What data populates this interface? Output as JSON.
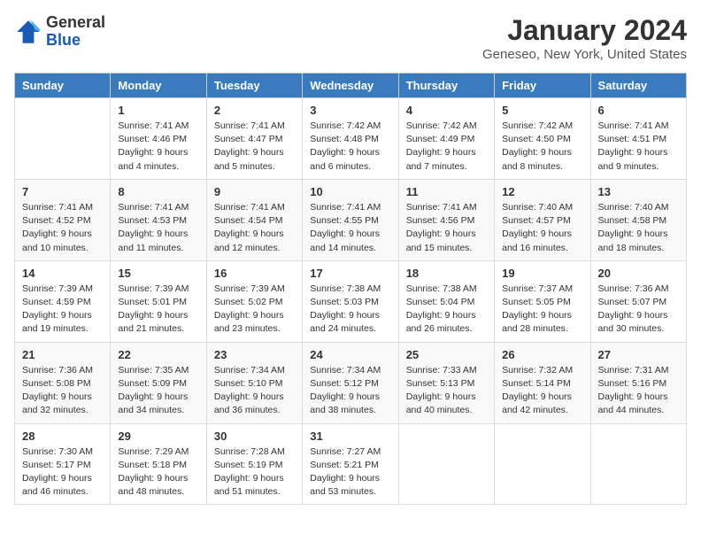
{
  "logo": {
    "line1": "General",
    "line2": "Blue"
  },
  "title": "January 2024",
  "subtitle": "Geneseo, New York, United States",
  "headers": [
    "Sunday",
    "Monday",
    "Tuesday",
    "Wednesday",
    "Thursday",
    "Friday",
    "Saturday"
  ],
  "weeks": [
    [
      {
        "date": "",
        "info": ""
      },
      {
        "date": "1",
        "info": "Sunrise: 7:41 AM\nSunset: 4:46 PM\nDaylight: 9 hours\nand 4 minutes."
      },
      {
        "date": "2",
        "info": "Sunrise: 7:41 AM\nSunset: 4:47 PM\nDaylight: 9 hours\nand 5 minutes."
      },
      {
        "date": "3",
        "info": "Sunrise: 7:42 AM\nSunset: 4:48 PM\nDaylight: 9 hours\nand 6 minutes."
      },
      {
        "date": "4",
        "info": "Sunrise: 7:42 AM\nSunset: 4:49 PM\nDaylight: 9 hours\nand 7 minutes."
      },
      {
        "date": "5",
        "info": "Sunrise: 7:42 AM\nSunset: 4:50 PM\nDaylight: 9 hours\nand 8 minutes."
      },
      {
        "date": "6",
        "info": "Sunrise: 7:41 AM\nSunset: 4:51 PM\nDaylight: 9 hours\nand 9 minutes."
      }
    ],
    [
      {
        "date": "7",
        "info": "Sunrise: 7:41 AM\nSunset: 4:52 PM\nDaylight: 9 hours\nand 10 minutes."
      },
      {
        "date": "8",
        "info": "Sunrise: 7:41 AM\nSunset: 4:53 PM\nDaylight: 9 hours\nand 11 minutes."
      },
      {
        "date": "9",
        "info": "Sunrise: 7:41 AM\nSunset: 4:54 PM\nDaylight: 9 hours\nand 12 minutes."
      },
      {
        "date": "10",
        "info": "Sunrise: 7:41 AM\nSunset: 4:55 PM\nDaylight: 9 hours\nand 14 minutes."
      },
      {
        "date": "11",
        "info": "Sunrise: 7:41 AM\nSunset: 4:56 PM\nDaylight: 9 hours\nand 15 minutes."
      },
      {
        "date": "12",
        "info": "Sunrise: 7:40 AM\nSunset: 4:57 PM\nDaylight: 9 hours\nand 16 minutes."
      },
      {
        "date": "13",
        "info": "Sunrise: 7:40 AM\nSunset: 4:58 PM\nDaylight: 9 hours\nand 18 minutes."
      }
    ],
    [
      {
        "date": "14",
        "info": "Sunrise: 7:39 AM\nSunset: 4:59 PM\nDaylight: 9 hours\nand 19 minutes."
      },
      {
        "date": "15",
        "info": "Sunrise: 7:39 AM\nSunset: 5:01 PM\nDaylight: 9 hours\nand 21 minutes."
      },
      {
        "date": "16",
        "info": "Sunrise: 7:39 AM\nSunset: 5:02 PM\nDaylight: 9 hours\nand 23 minutes."
      },
      {
        "date": "17",
        "info": "Sunrise: 7:38 AM\nSunset: 5:03 PM\nDaylight: 9 hours\nand 24 minutes."
      },
      {
        "date": "18",
        "info": "Sunrise: 7:38 AM\nSunset: 5:04 PM\nDaylight: 9 hours\nand 26 minutes."
      },
      {
        "date": "19",
        "info": "Sunrise: 7:37 AM\nSunset: 5:05 PM\nDaylight: 9 hours\nand 28 minutes."
      },
      {
        "date": "20",
        "info": "Sunrise: 7:36 AM\nSunset: 5:07 PM\nDaylight: 9 hours\nand 30 minutes."
      }
    ],
    [
      {
        "date": "21",
        "info": "Sunrise: 7:36 AM\nSunset: 5:08 PM\nDaylight: 9 hours\nand 32 minutes."
      },
      {
        "date": "22",
        "info": "Sunrise: 7:35 AM\nSunset: 5:09 PM\nDaylight: 9 hours\nand 34 minutes."
      },
      {
        "date": "23",
        "info": "Sunrise: 7:34 AM\nSunset: 5:10 PM\nDaylight: 9 hours\nand 36 minutes."
      },
      {
        "date": "24",
        "info": "Sunrise: 7:34 AM\nSunset: 5:12 PM\nDaylight: 9 hours\nand 38 minutes."
      },
      {
        "date": "25",
        "info": "Sunrise: 7:33 AM\nSunset: 5:13 PM\nDaylight: 9 hours\nand 40 minutes."
      },
      {
        "date": "26",
        "info": "Sunrise: 7:32 AM\nSunset: 5:14 PM\nDaylight: 9 hours\nand 42 minutes."
      },
      {
        "date": "27",
        "info": "Sunrise: 7:31 AM\nSunset: 5:16 PM\nDaylight: 9 hours\nand 44 minutes."
      }
    ],
    [
      {
        "date": "28",
        "info": "Sunrise: 7:30 AM\nSunset: 5:17 PM\nDaylight: 9 hours\nand 46 minutes."
      },
      {
        "date": "29",
        "info": "Sunrise: 7:29 AM\nSunset: 5:18 PM\nDaylight: 9 hours\nand 48 minutes."
      },
      {
        "date": "30",
        "info": "Sunrise: 7:28 AM\nSunset: 5:19 PM\nDaylight: 9 hours\nand 51 minutes."
      },
      {
        "date": "31",
        "info": "Sunrise: 7:27 AM\nSunset: 5:21 PM\nDaylight: 9 hours\nand 53 minutes."
      },
      {
        "date": "",
        "info": ""
      },
      {
        "date": "",
        "info": ""
      },
      {
        "date": "",
        "info": ""
      }
    ]
  ]
}
